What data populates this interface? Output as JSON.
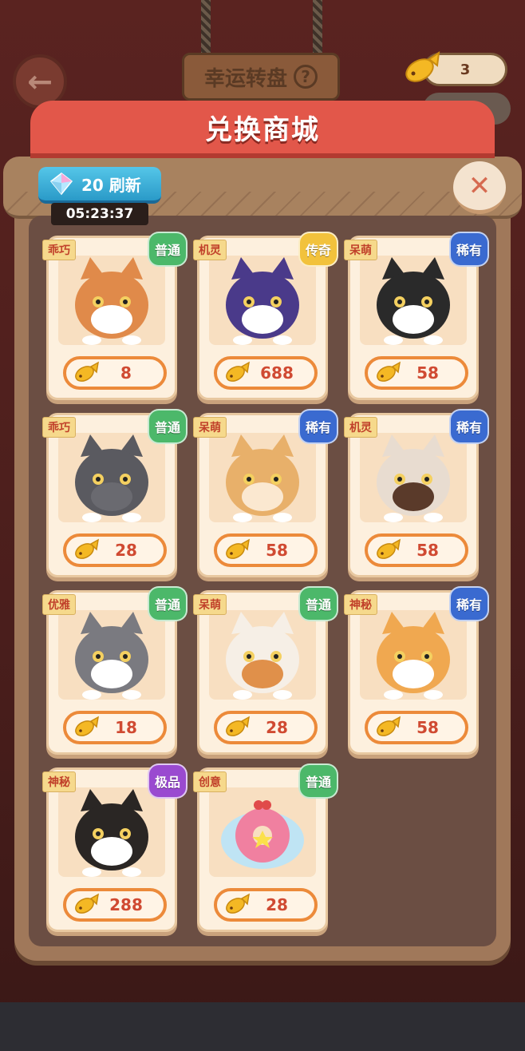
{
  "top": {
    "lucky_wheel_label": "幸运转盘",
    "lucky_wheel_help": "?",
    "back_glyph": "←",
    "coin_count": "3"
  },
  "panel": {
    "title": "兑换商城",
    "refresh_label": "20 刷新",
    "timer": "05:23:37",
    "close_glyph": "✕"
  },
  "colors": {
    "accent_red": "#e2574a",
    "refresh_blue": "#2a9ac8",
    "price_orange": "#ec8a3a",
    "common_green": "#4cb86a",
    "rare_blue": "#3a6ad0",
    "legend_gold": "#f2c23c",
    "epic_purple": "#9a4ad0"
  },
  "items": [
    {
      "tag": "乖巧",
      "rarity": "普通",
      "price": "8",
      "icon": "orange-cat-icon"
    },
    {
      "tag": "机灵",
      "rarity": "传奇",
      "price": "688",
      "icon": "purple-cat-icon"
    },
    {
      "tag": "呆萌",
      "rarity": "稀有",
      "price": "58",
      "icon": "tuxedo-cat-icon"
    },
    {
      "tag": "乖巧",
      "rarity": "普通",
      "price": "28",
      "icon": "gray-cat-icon"
    },
    {
      "tag": "呆萌",
      "rarity": "稀有",
      "price": "58",
      "icon": "shiba-cat-icon"
    },
    {
      "tag": "机灵",
      "rarity": "稀有",
      "price": "58",
      "icon": "siamese-cat-icon"
    },
    {
      "tag": "优雅",
      "rarity": "普通",
      "price": "18",
      "icon": "gray-white-cat-icon"
    },
    {
      "tag": "呆萌",
      "rarity": "普通",
      "price": "28",
      "icon": "calico-cat-icon"
    },
    {
      "tag": "神秘",
      "rarity": "稀有",
      "price": "58",
      "icon": "tiger-cat-icon"
    },
    {
      "tag": "神秘",
      "rarity": "极品",
      "price": "288",
      "icon": "black-cat-icon"
    },
    {
      "tag": "创意",
      "rarity": "普通",
      "price": "28",
      "icon": "donut-icon"
    }
  ]
}
